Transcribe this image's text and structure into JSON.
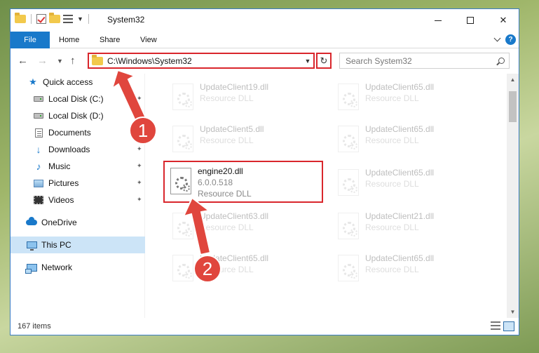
{
  "window": {
    "title": "System32"
  },
  "ribbon": {
    "tabs": [
      {
        "label": "File"
      },
      {
        "label": "Home"
      },
      {
        "label": "Share"
      },
      {
        "label": "View"
      }
    ]
  },
  "address": {
    "path": "C:\\Windows\\System32"
  },
  "search": {
    "placeholder": "Search System32"
  },
  "sidebar": {
    "items": [
      {
        "label": "Quick access",
        "icon": "star-icon"
      },
      {
        "label": "Local Disk (C:)",
        "icon": "disk-icon",
        "pinned": true
      },
      {
        "label": "Local Disk (D:)",
        "icon": "disk-icon",
        "pinned": true
      },
      {
        "label": "Documents",
        "icon": "documents-icon",
        "pinned": true
      },
      {
        "label": "Downloads",
        "icon": "download-icon",
        "pinned": true
      },
      {
        "label": "Music",
        "icon": "music-icon",
        "pinned": true
      },
      {
        "label": "Pictures",
        "icon": "pictures-icon",
        "pinned": true
      },
      {
        "label": "Videos",
        "icon": "videos-icon",
        "pinned": true
      },
      {
        "label": "OneDrive",
        "icon": "cloud-icon"
      },
      {
        "label": "This PC",
        "icon": "computer-icon",
        "selected": true
      },
      {
        "label": "Network",
        "icon": "network-icon"
      }
    ]
  },
  "files": {
    "left": [
      {
        "name": "UpdateClient19.dll",
        "type": "Resource DLL"
      },
      {
        "name": "UpdateClient5.dll",
        "type": "Resource DLL"
      },
      {
        "name": "engine20.dll",
        "version": "6.0.0.518",
        "type": "Resource DLL"
      },
      {
        "name": "UpdateClient63.dll",
        "type": "Resource DLL"
      },
      {
        "name": "UpdateClient65.dll",
        "type": "Resource DLL"
      }
    ],
    "right": [
      {
        "name": "UpdateClient65.dll",
        "type": "Resource DLL"
      },
      {
        "name": "UpdateClient65.dll",
        "type": "Resource DLL"
      },
      {
        "name": "UpdateClient65.dll",
        "type": "Resource DLL"
      },
      {
        "name": "UpdateClient21.dll",
        "type": "Resource DLL"
      },
      {
        "name": "UpdateClient65.dll",
        "type": "Resource DLL"
      }
    ]
  },
  "status": {
    "item_count": "167 items"
  },
  "annotations": {
    "step1": "1",
    "step2": "2"
  },
  "colors": {
    "accent": "#1979ca",
    "highlight_border": "#d9262c",
    "callout": "#e0463d",
    "selected_bg": "#cce4f7"
  }
}
